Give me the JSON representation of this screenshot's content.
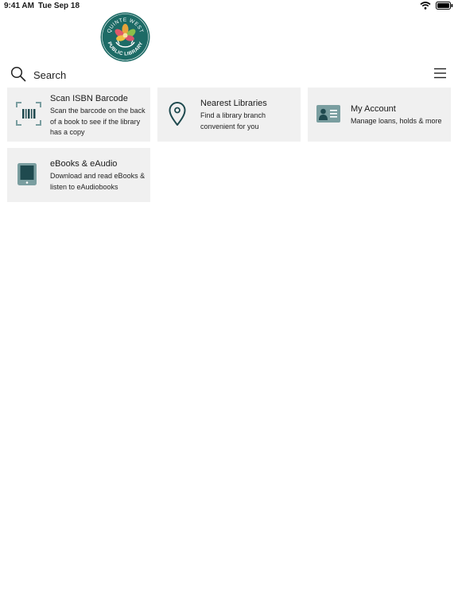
{
  "status": {
    "time": "9:41 AM",
    "date": "Tue Sep 18"
  },
  "logo": {
    "top_text": "QUINTE WEST",
    "bottom_text": "PUBLIC LIBRARY"
  },
  "search": {
    "placeholder": "Search"
  },
  "cards": [
    {
      "title": "Scan ISBN Barcode",
      "description": "Scan the barcode on the back of a book to see if the library has a copy",
      "icon": "barcode-icon"
    },
    {
      "title": "Nearest Libraries",
      "description": "Find a library branch convenient for you",
      "icon": "map-pin-icon"
    },
    {
      "title": "My Account",
      "description": "Manage loans, holds & more",
      "icon": "id-card-icon"
    },
    {
      "title": "eBooks & eAudio",
      "description": "Download and read eBooks & listen to eAudiobooks",
      "icon": "tablet-icon"
    }
  ],
  "colors": {
    "brand_teal": "#1d6b66",
    "icon_dark": "#1f4a4f",
    "icon_gray": "#7a9ea0",
    "card_bg": "#f0f0f0"
  }
}
